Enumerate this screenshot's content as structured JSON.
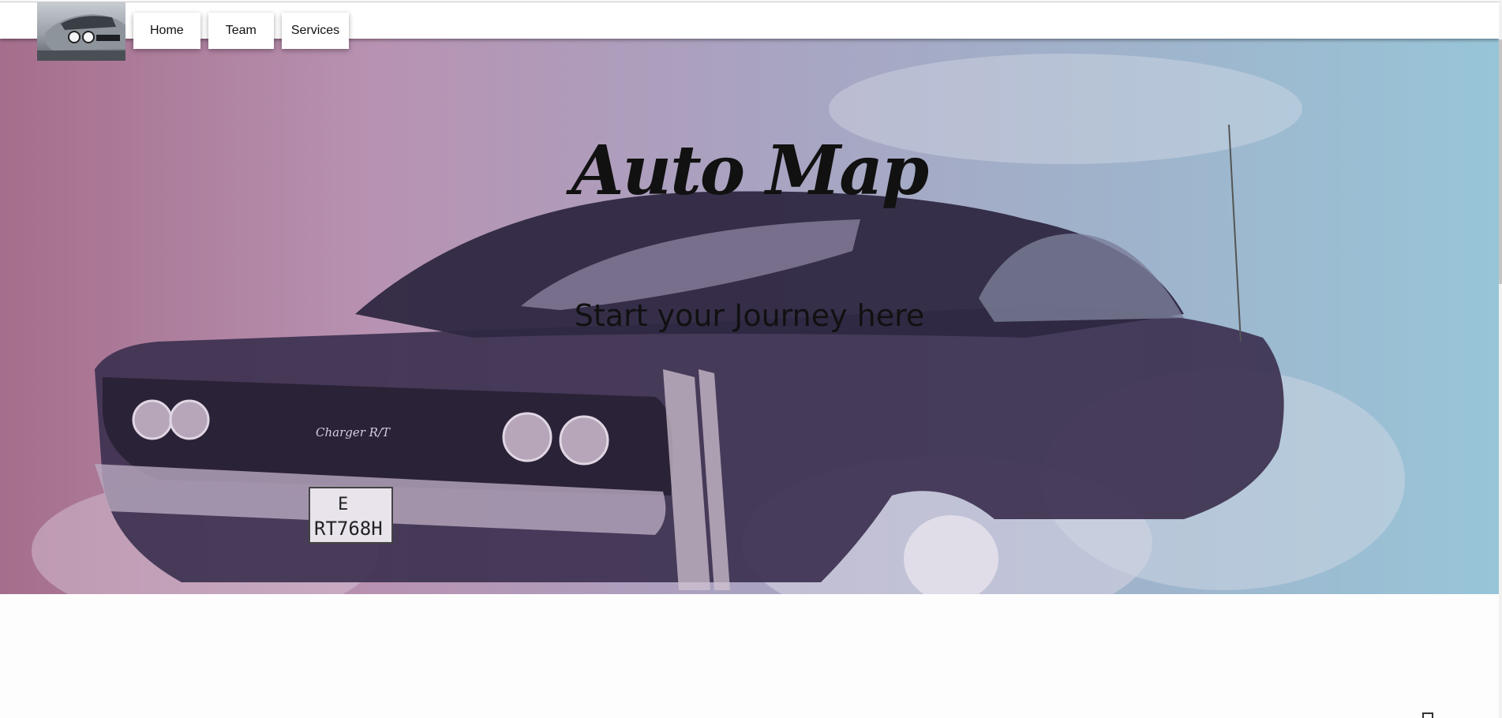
{
  "header": {
    "logo_icon": "car-logo",
    "nav": [
      {
        "label": "Home"
      },
      {
        "label": "Team"
      },
      {
        "label": "Services"
      }
    ]
  },
  "hero": {
    "title": "Auto Map",
    "subtitle": "Start your Journey here",
    "image": "muscle-car-burnout",
    "plate_line1": "E",
    "plate_line2": "RT768H",
    "badge_text": "Charger R/T",
    "gradient": [
      "#a56e8b",
      "#98c5d8"
    ]
  }
}
